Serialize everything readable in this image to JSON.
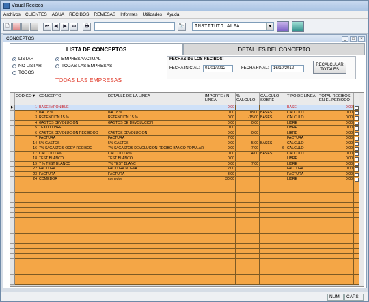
{
  "app": {
    "title": "Visual Recibos",
    "menu": [
      "Archivos",
      "CLIENTES",
      "AGUA",
      "RECIBOS",
      "REMESAS",
      "Informes",
      "Utilidades",
      "Ayuda"
    ],
    "company_select": "INSTITUTO ALFA",
    "toolbar_glyphs": {
      "new": "🗋",
      "first": "⏮",
      "prev": "◀",
      "next": "▶",
      "last": "⏭",
      "print": "🖶",
      "binoculars": "🔭"
    }
  },
  "window": {
    "title": "CONCEPTOS",
    "tabs": {
      "list": "LISTA DE CONCEPTOS",
      "detail": "DETALLES DEL CONCEPTO"
    }
  },
  "filters": {
    "radio_left": [
      {
        "label": "LISTAR",
        "on": true
      },
      {
        "label": "NO LISTAR",
        "on": false
      },
      {
        "label": "TODOS",
        "on": false
      }
    ],
    "radio_right": [
      {
        "label": "EMPRESAACTUAL",
        "on": true
      },
      {
        "label": "TODAS LAS EMPRESAS",
        "on": false
      }
    ],
    "all_companies_label": "TODAS LAS EMPRESAS"
  },
  "dates": {
    "header": "FECHAS DE LOS RECIBOS:",
    "start_label": "FECHA INICIAL:",
    "start_value": "01/01/2012",
    "end_label": "FECHA FINAL:",
    "end_value": "16/10/2012",
    "recalc_label": "RECALCULAR TOTALES"
  },
  "grid": {
    "columns": [
      "CODIGO",
      "CONCEPTO",
      "DETALLE DE LA LINEA",
      "IMPORTE / N LINEA",
      "% CALCULO",
      "CALCULO SOBRE",
      "TIPO DE LINEA",
      "TOTAL RECIBOS EN EL PERIODO"
    ],
    "sort_indicator": "▼",
    "selected_marker": "▶",
    "rows": [
      {
        "code": "1",
        "concept": "BASE IMPONIBLE",
        "detail": "",
        "amount": "0,00",
        "pct": "",
        "over": "",
        "type": "BASE",
        "total": "0,00",
        "red": true,
        "selected": true
      },
      {
        "code": "2",
        "concept": "IVA 18 %",
        "detail": "IVA 18 %",
        "amount": "0,00",
        "pct": "18,00",
        "over": "BASES",
        "type": "CALCULO",
        "total": "0,00"
      },
      {
        "code": "3",
        "concept": "RETENCION 15 %",
        "detail": "RETENCION 15 %",
        "amount": "0,00",
        "pct": "-15,00",
        "over": "BASES",
        "type": "CALCULO",
        "total": "0,00"
      },
      {
        "code": "4",
        "concept": "GASTOS DEVOLUCION",
        "detail": "GASTOS DE DEVOLUCION",
        "amount": "0,00",
        "pct": "0,00",
        "over": "",
        "type": "LIBRE",
        "total": "0,00"
      },
      {
        "code": "5",
        "concept": "TEXTO LIBRE",
        "detail": "",
        "amount": "0,00",
        "pct": "",
        "over": "",
        "type": "LIBRE",
        "total": "0,00"
      },
      {
        "code": "6",
        "concept": "GASTOS DEVOLUCION RECIBOOO",
        "detail": "GASTOS DEVOLUCION",
        "amount": "0,00",
        "pct": "0,00",
        "over": "",
        "type": "LIBRE",
        "total": "0,00"
      },
      {
        "code": "7",
        "concept": "FACTURA",
        "detail": "FACTURA",
        "amount": "7,00",
        "pct": "",
        "over": "",
        "type": "FACTURA",
        "total": "0,00"
      },
      {
        "code": "14",
        "concept": "5% GASTOS",
        "detail": "5% GASTOS",
        "amount": "0,00",
        "pct": "5,00",
        "over": "BASES",
        "type": "CALCULO",
        "total": "0,00"
      },
      {
        "code": "16",
        "concept": "7% S/ GASTOS ODEV RECIBOO",
        "detail": "7% S/ GASTOS DEVOLUCION RECIBO BANCO POPULAR",
        "amount": "0,00",
        "pct": "7,00",
        "over": "",
        "type": "CALCULO",
        "total": "0,00",
        "extra": "6"
      },
      {
        "code": "17",
        "concept": "CALCULO 4%",
        "detail": "CALCULO 4 %",
        "amount": "0,00",
        "pct": "4,00",
        "over": "BASES",
        "type": "CALCULO",
        "total": "0,00"
      },
      {
        "code": "18",
        "concept": "TEST BLANCO",
        "detail": "TEST BLANCO",
        "amount": "0,00",
        "pct": "",
        "over": "",
        "type": "LIBRE",
        "total": "0,00"
      },
      {
        "code": "19",
        "concept": "7 % TEST BLANCO",
        "detail": "7% TEST BLANC",
        "amount": "0,00",
        "pct": "7,00",
        "over": "",
        "type": "LIBRE",
        "total": "0,00"
      },
      {
        "code": "22",
        "concept": "FACTURA",
        "detail": "FACTURA NUEVA",
        "amount": "2,00",
        "pct": "",
        "over": "",
        "type": "FACTURA",
        "total": "0,00"
      },
      {
        "code": "23",
        "concept": "FACTURA",
        "detail": "FACTURA",
        "amount": "3,00",
        "pct": "",
        "over": "",
        "type": "FACTURA",
        "total": "0,00"
      },
      {
        "code": "24",
        "concept": "COMEDOR",
        "detail": "comedor",
        "amount": "30,00",
        "pct": "",
        "over": "",
        "type": "LIBRE",
        "total": "0,00"
      }
    ]
  },
  "status": {
    "num": "NUM",
    "caps": "CAPS"
  },
  "colors": {
    "row_fill": "#f4a646",
    "selected_row": "#cfe1f8",
    "red_text": "#d11818"
  }
}
